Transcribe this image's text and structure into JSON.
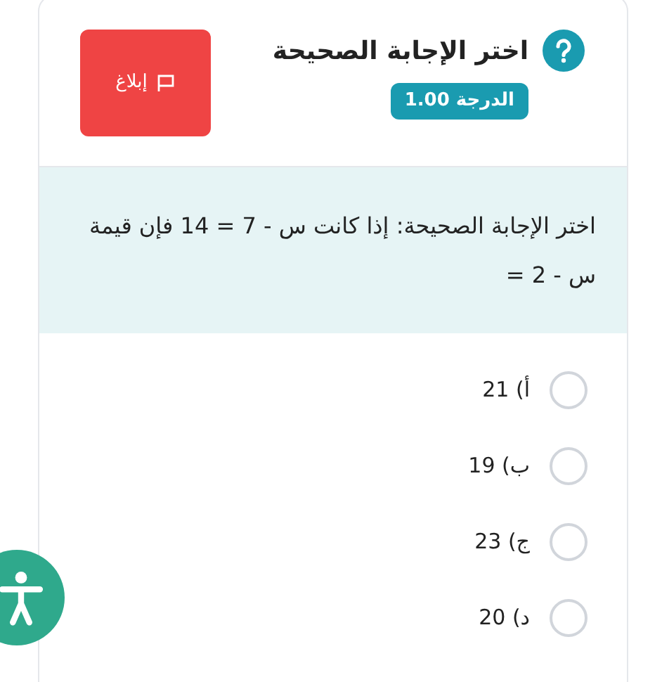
{
  "question": {
    "title": "اختر الإجابة الصحيحة",
    "grade": "الدرجة 1.00",
    "report_button": "إبلاغ",
    "text": "اختر الإجابة الصحيحة:  إذا كانت س - 7 = 14 فإن قيمة س - 2 =",
    "options": [
      {
        "label": "أ) 21",
        "selected": false
      },
      {
        "label": "ب) 19",
        "selected": false
      },
      {
        "label": "ج) 23",
        "selected": false
      },
      {
        "label": "د) 20",
        "selected": false
      }
    ]
  }
}
